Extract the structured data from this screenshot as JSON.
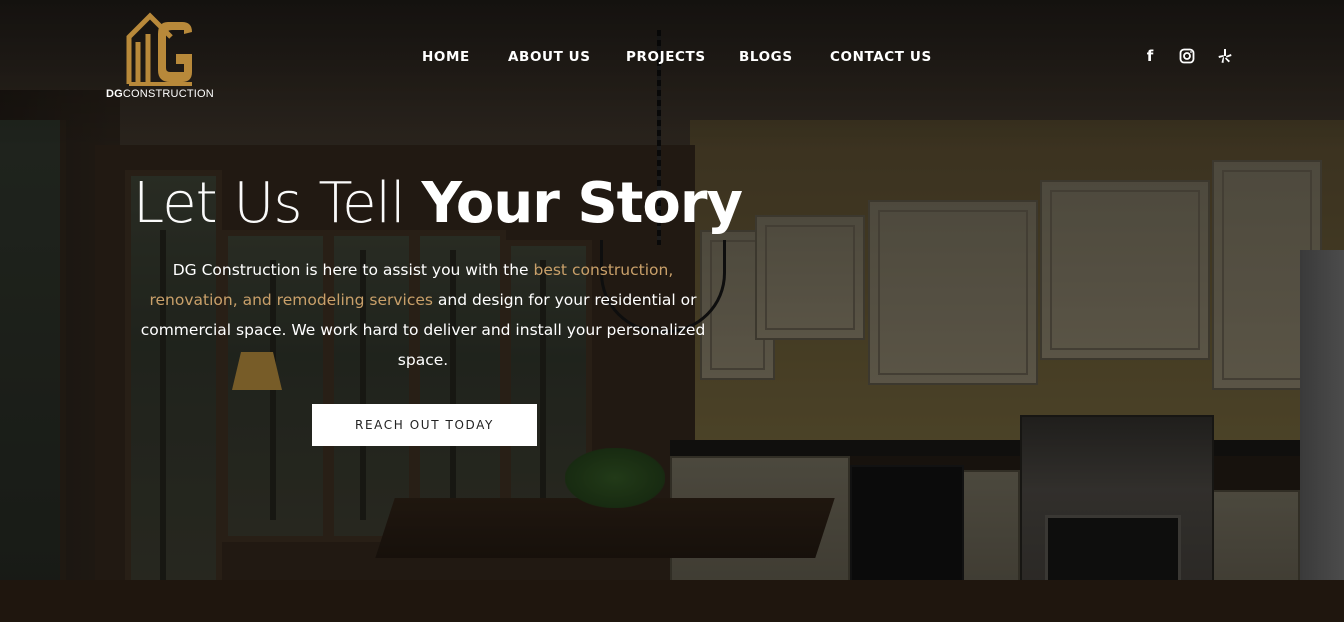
{
  "logo": {
    "text_bold": "DG",
    "text_rest": "CONSTRUCTION",
    "brand_color": "#b8893a"
  },
  "nav": {
    "items": [
      {
        "label": "HOME"
      },
      {
        "label": "ABOUT US"
      },
      {
        "label": "PROJECTS"
      },
      {
        "label": "BLOGS"
      },
      {
        "label": "CONTACT US"
      }
    ]
  },
  "social": {
    "icons": [
      "facebook-icon",
      "instagram-icon",
      "yelp-icon"
    ],
    "facebook_glyph": "f"
  },
  "hero": {
    "headline_thin": "Let Us Tell ",
    "headline_bold": "Your Story",
    "subtext_1": "DG Construction is here to assist you with the ",
    "subtext_accent": "best construction, renovation, and remodeling services",
    "subtext_2": " and design for your residential or commercial space. We work hard to deliver and install your personalized space.",
    "accent_color": "#c9a06a",
    "cta_label": "REACH OUT TODAY"
  }
}
